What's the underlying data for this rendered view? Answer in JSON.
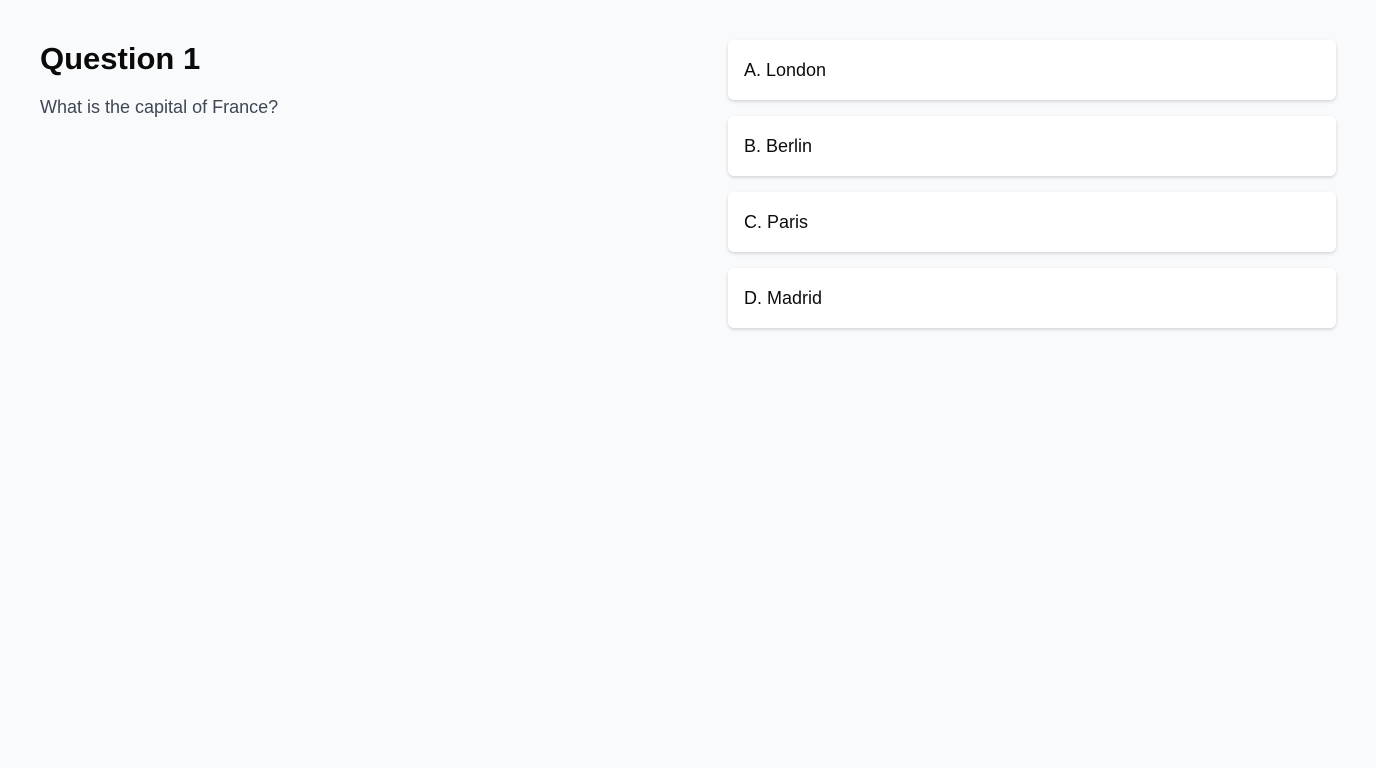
{
  "question": {
    "title": "Question 1",
    "text": "What is the capital of France?"
  },
  "answers": [
    {
      "label": "A. London"
    },
    {
      "label": "B. Berlin"
    },
    {
      "label": "C. Paris"
    },
    {
      "label": "D. Madrid"
    }
  ],
  "colors": {
    "background": "#f8fafc",
    "card": "#ffffff",
    "title": "#0a0a0a",
    "question_text": "#3f4654",
    "answer_text": "#0b0b0b"
  }
}
